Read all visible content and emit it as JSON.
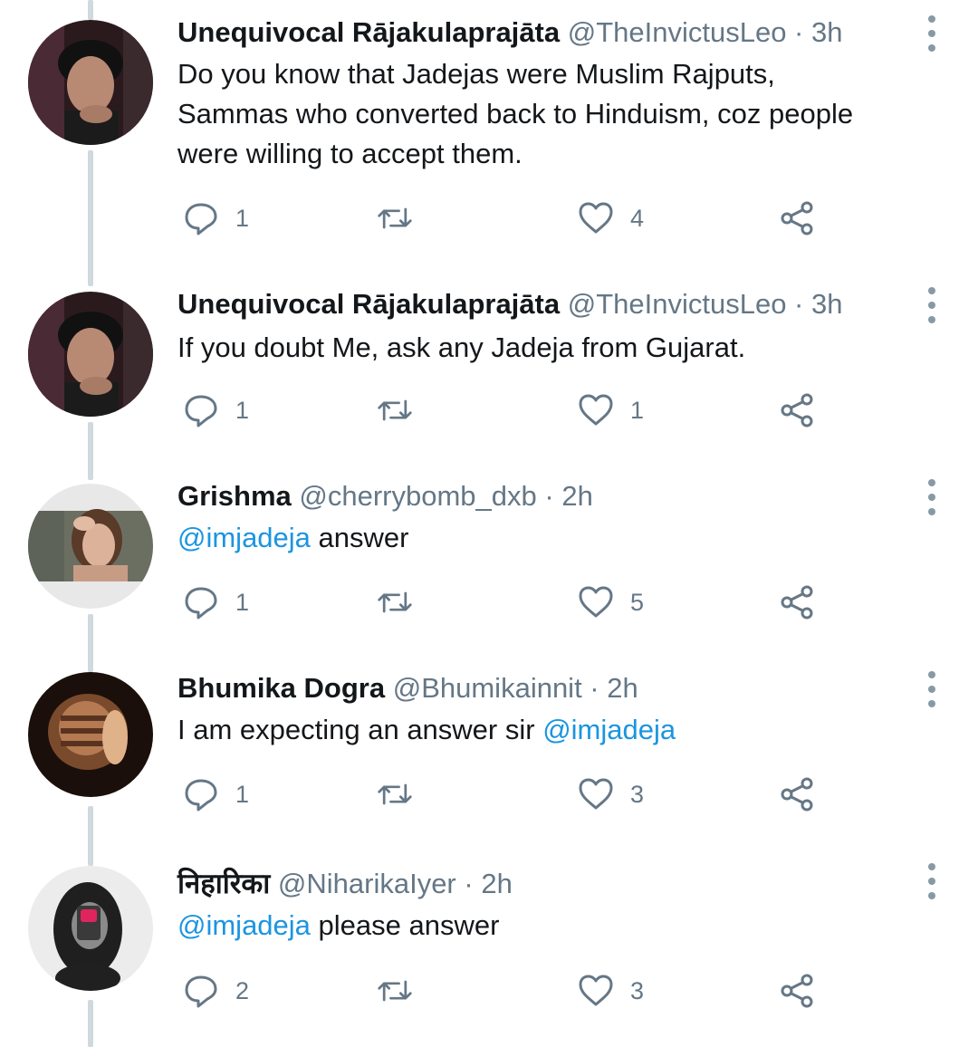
{
  "tweets": [
    {
      "name": "Unequivocal Rājakulaprajāta",
      "handle": "@TheInvictusLeo",
      "dot": " · ",
      "time": "3h",
      "lines": [
        "Do you know that Jadejas were Muslim Rajputs,",
        "Sammas who converted back to Hinduism, coz people",
        "were willing to accept them."
      ],
      "replies": "1",
      "retweets": "",
      "likes": "4"
    },
    {
      "name": "Unequivocal Rājakulaprajāta",
      "handle": "@TheInvictusLeo",
      "dot": " · ",
      "time": "3h",
      "text": "If you doubt Me, ask any Jadeja from Gujarat.",
      "replies": "1",
      "retweets": "",
      "likes": "1"
    },
    {
      "name": "Grishma",
      "handle": "@cherrybomb_dxb",
      "dot": " · ",
      "time": "2h",
      "mention": "@imjadeja",
      "text_after": " answer",
      "replies": "1",
      "retweets": "",
      "likes": "5"
    },
    {
      "name": "Bhumika Dogra",
      "handle": "@Bhumikainnit",
      "dot": " · ",
      "time": "2h",
      "text_before": "I am expecting an answer sir ",
      "mention": "@imjadeja",
      "replies": "1",
      "retweets": "",
      "likes": "3"
    },
    {
      "name": "निहारिका",
      "handle": "@NiharikaIyer",
      "dot": " · ",
      "time": "2h",
      "mention": "@imjadeja",
      "text_after": " please answer",
      "replies": "2",
      "retweets": "",
      "likes": "3"
    }
  ],
  "icons": {
    "reply": "reply-icon",
    "retweet": "retweet-icon",
    "like": "heart-icon",
    "share": "share-icon",
    "more": "more-vertical-icon"
  },
  "colors": {
    "text": "#14171a",
    "secondary": "#657786",
    "link": "#1b95e0",
    "thread_line": "#cfd9de"
  }
}
